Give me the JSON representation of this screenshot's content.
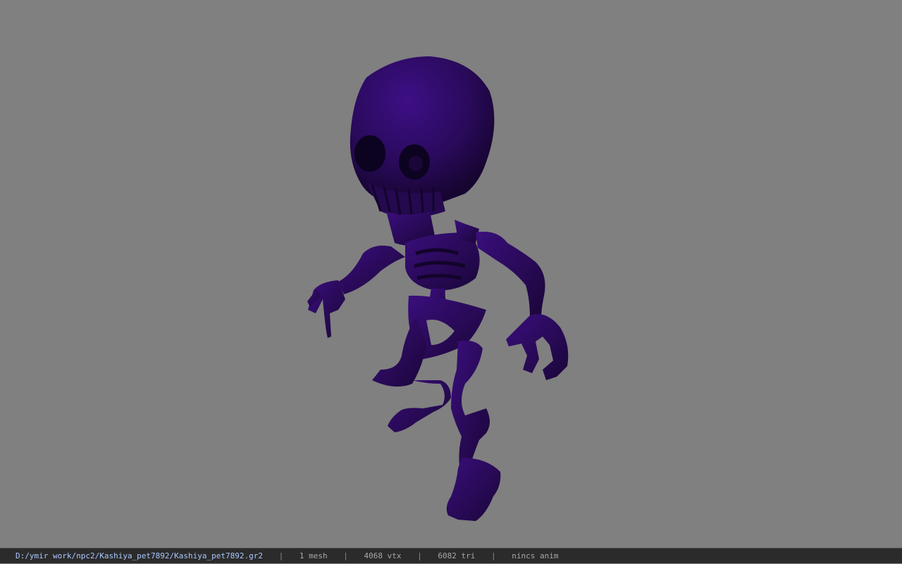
{
  "viewport": {
    "background": "#808080",
    "model_name": "Kashiya_pet7892",
    "model_color": "#2a0a5c"
  },
  "statusbar": {
    "file_path": "D:/ymir work/npc2/Kashiya_pet7892/Kashiya_pet7892.gr2",
    "separator": "|",
    "mesh_count": "1 mesh",
    "vertex_count": "4068 vtx",
    "triangle_count": "6082 tri",
    "anim": "nincs anim"
  }
}
